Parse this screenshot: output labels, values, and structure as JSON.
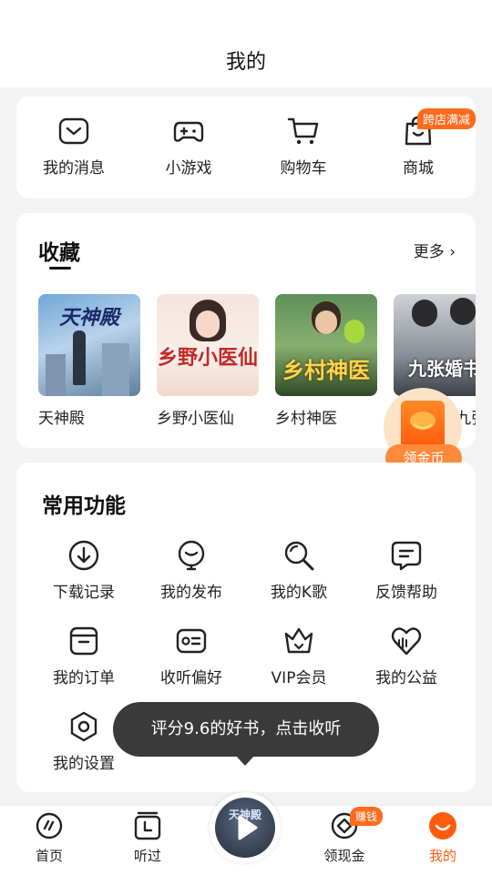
{
  "header": {
    "title": "我的"
  },
  "shortcuts": [
    {
      "label": "我的消息",
      "icon": "message-icon"
    },
    {
      "label": "小游戏",
      "icon": "gamepad-icon"
    },
    {
      "label": "购物车",
      "icon": "cart-icon"
    },
    {
      "label": "商城",
      "icon": "shopping-bag-icon",
      "badge": "跨店满减"
    }
  ],
  "favorites": {
    "title": "收藏",
    "more": "更多",
    "books": [
      {
        "title": "天神殿",
        "cover_text": "天神殿"
      },
      {
        "title": "乡野小医仙",
        "cover_text": "乡野小医仙"
      },
      {
        "title": "乡村神医",
        "cover_text": "乡村神医"
      },
      {
        "title": "都市神医九张婚书",
        "cover_text": "九张婚书"
      }
    ]
  },
  "coin_float": {
    "label": "领金币"
  },
  "functions": {
    "title": "常用功能",
    "items": [
      {
        "label": "下载记录",
        "icon": "download-icon"
      },
      {
        "label": "我的发布",
        "icon": "publish-icon"
      },
      {
        "label": "我的K歌",
        "icon": "microphone-icon"
      },
      {
        "label": "反馈帮助",
        "icon": "feedback-icon"
      },
      {
        "label": "我的订单",
        "icon": "order-icon"
      },
      {
        "label": "收听偏好",
        "icon": "preference-icon"
      },
      {
        "label": "VIP会员",
        "icon": "crown-icon"
      },
      {
        "label": "我的公益",
        "icon": "charity-icon"
      },
      {
        "label": "我的设置",
        "icon": "settings-icon"
      }
    ]
  },
  "toast": {
    "text": "评分9.6的好书，点击收听"
  },
  "bottom_nav": {
    "items": [
      {
        "label": "首页",
        "icon": "home-icon"
      },
      {
        "label": "听过",
        "icon": "history-icon"
      },
      {
        "label": "领现金",
        "icon": "cash-icon",
        "badge": "赚钱"
      },
      {
        "label": "我的",
        "icon": "profile-icon",
        "active": true
      }
    ],
    "player": {
      "cover_text": "天神殿",
      "icon": "play-icon"
    }
  },
  "colors": {
    "accent": "#ff5a0d",
    "badge": "#ff6a1e",
    "toast_bg": "#3a3a3a"
  }
}
